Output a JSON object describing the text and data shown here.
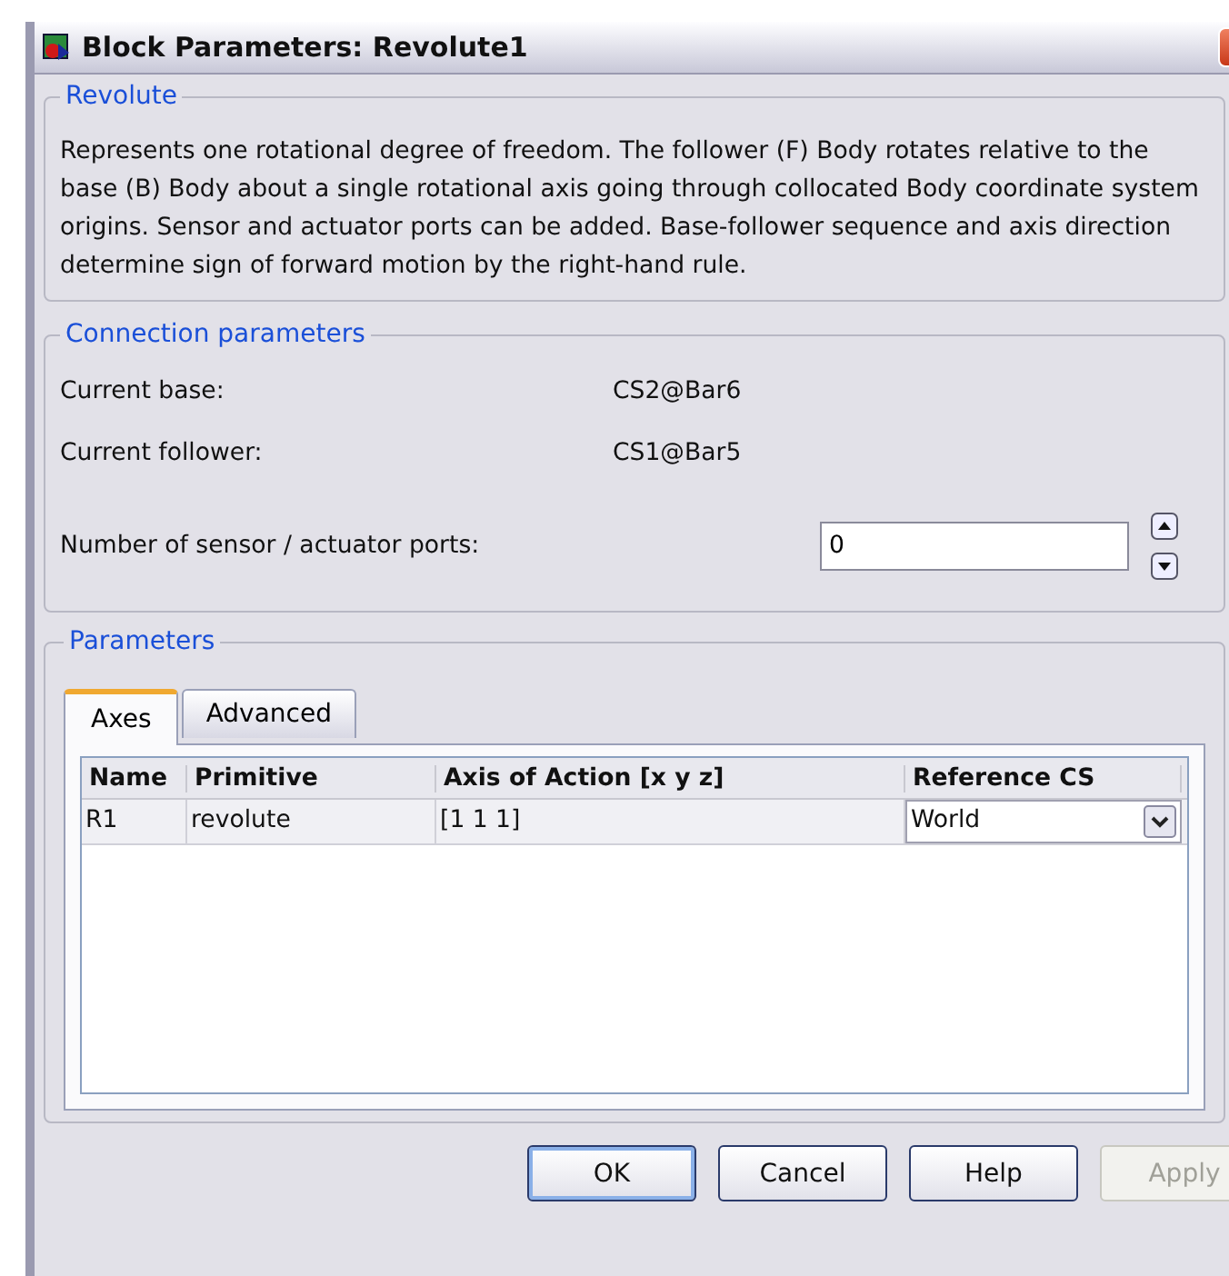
{
  "window": {
    "title": "Block Parameters: Revolute1"
  },
  "revolute": {
    "legend": "Revolute",
    "description": "Represents one rotational degree of freedom. The follower (F) Body rotates relative to the base (B) Body about a single rotational axis going through collocated Body coordinate system origins. Sensor and actuator ports can be added. Base-follower sequence and axis direction determine sign of forward motion by the right-hand rule."
  },
  "connection": {
    "legend": "Connection parameters",
    "fields": [
      {
        "kind": "readout",
        "label": "Current base:",
        "value": "CS2@Bar6"
      },
      {
        "kind": "readout",
        "label": "Current follower:",
        "value": "CS1@Bar5"
      },
      {
        "kind": "spinner",
        "label": "Number of sensor / actuator ports:",
        "value": "0"
      }
    ]
  },
  "parameters": {
    "legend": "Parameters",
    "tabs": [
      {
        "label": "Axes",
        "selected": true
      },
      {
        "label": "Advanced",
        "selected": false
      }
    ],
    "table": {
      "columns": [
        "Name",
        "Primitive",
        "Axis of Action [x y z]",
        "Reference CS"
      ],
      "rows": [
        {
          "name": "R1",
          "primitive": "revolute",
          "axis": "[1 1 1]",
          "reference": "World"
        }
      ]
    }
  },
  "buttons": [
    {
      "label": "OK",
      "disabled": false,
      "default": true
    },
    {
      "label": "Cancel",
      "disabled": false,
      "default": false
    },
    {
      "label": "Help",
      "disabled": false,
      "default": false
    },
    {
      "label": "Apply",
      "disabled": true,
      "default": false
    }
  ]
}
